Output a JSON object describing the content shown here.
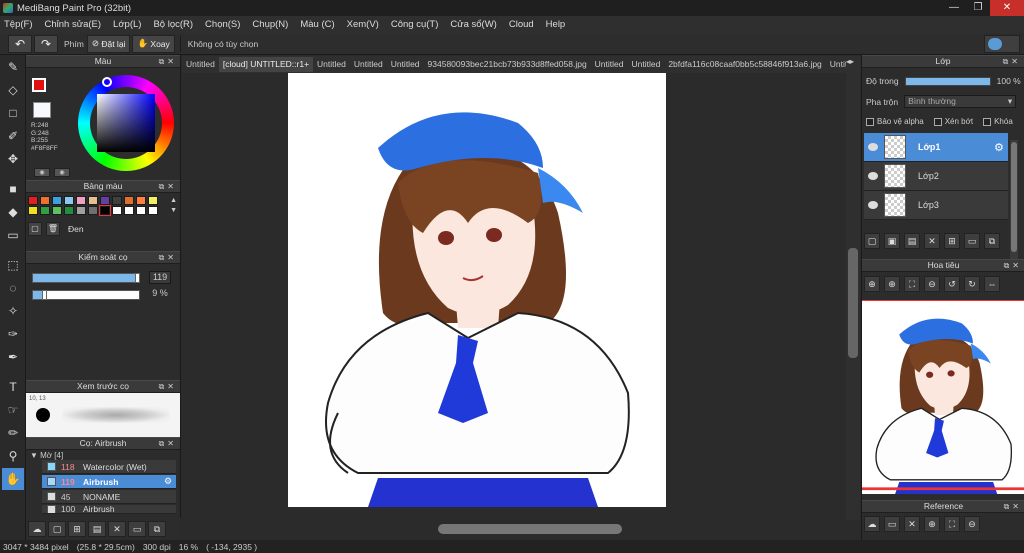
{
  "window": {
    "title": "MediBang Paint Pro (32bit)",
    "min": "—",
    "restore": "❐",
    "close": "✕"
  },
  "menu": [
    {
      "label": "Tệp(F)"
    },
    {
      "label": "Chỉnh sửa(E)"
    },
    {
      "label": "Lớp(L)"
    },
    {
      "label": "Bộ lọc(R)"
    },
    {
      "label": "Chọn(S)"
    },
    {
      "label": "Chụp(N)"
    },
    {
      "label": "Màu (C)"
    },
    {
      "label": "Xem(V)"
    },
    {
      "label": "Công cụ(T)"
    },
    {
      "label": "Cửa sổ(W)"
    },
    {
      "label": "Cloud"
    },
    {
      "label": "Help"
    }
  ],
  "toolbar": {
    "undo": "↶",
    "redo": "↷",
    "key_label": "Phím",
    "reset_label": "Đặt lại",
    "rotate_label": "Xoay",
    "no_options": "Không có tùy chọn"
  },
  "panels": {
    "color": "Màu",
    "palette": "Bảng màu",
    "brush_control": "Kiểm soát cọ",
    "brush_preview": "Xem trước cọ",
    "brush": "Cọ: Airbrush",
    "layer": "Lớp",
    "navigator": "Hoa tiêu",
    "reference": "Reference"
  },
  "color": {
    "r": "R:248",
    "g": "G:248",
    "b": "B:255",
    "hex": "#F8F8FF",
    "fg": "#e01010",
    "bg": "#f8f8ff"
  },
  "palette": {
    "colors": [
      "#e02020",
      "#f07030",
      "#3aa0e0",
      "#8ac8f0",
      "#f0a0c0",
      "#e8c090",
      "#6040a0",
      "#404040",
      "#e07030",
      "#ff8040",
      "#f0f060",
      "#f0e020",
      "#30a040",
      "#60c060",
      "#209040",
      "#a0a0a0",
      "#707070",
      "#000000",
      "#ffffff",
      "#ffffff",
      "#ffffff",
      "#ffffff"
    ],
    "selected_name": "Đen"
  },
  "brush_control": {
    "size_value": "119",
    "size_fraction": 0.98,
    "opacity_value": "9 %",
    "opacity_fraction": 0.09
  },
  "brush_preview": {
    "label": "10, 13"
  },
  "brush_list": {
    "group": "Mờ [4]",
    "items": [
      {
        "num": "118",
        "name": "Watercolor (Wet)",
        "color": "#8ad8f8",
        "active": false
      },
      {
        "num": "119",
        "name": "Airbrush",
        "color": "#a8d8f8",
        "active": true
      },
      {
        "num": "45",
        "name": "NONAME",
        "color": "#dddddd",
        "active": false
      },
      {
        "num": "100",
        "name": "Airbrush",
        "color": "#dddddd",
        "active": false
      }
    ]
  },
  "tabs": [
    {
      "label": "Untitled",
      "active": false
    },
    {
      "label": "[cloud] UNTITLED::r1+",
      "active": true
    },
    {
      "label": "Untitled",
      "active": false
    },
    {
      "label": "Untitled",
      "active": false
    },
    {
      "label": "Untitled",
      "active": false
    },
    {
      "label": "934580093bec21bcb73b933d8ffed058.jpg",
      "active": false
    },
    {
      "label": "Untitled",
      "active": false
    },
    {
      "label": "Untitled",
      "active": false
    },
    {
      "label": "2bfdfa116c08caaf0bb5c58846f913a6.jpg",
      "active": false
    },
    {
      "label": "Untitled",
      "active": false
    }
  ],
  "layer": {
    "opacity_label": "Độ trong",
    "opacity_value": "100 %",
    "opacity_fraction": 1.0,
    "blend_label": "Pha trộn",
    "blend_value": "Bình thường",
    "protect_alpha": "Bảo vệ alpha",
    "clipping": "Xén bớt",
    "lock": "Khóa",
    "layers": [
      {
        "name": "Lớp1",
        "active": true
      },
      {
        "name": "Lớp2",
        "active": false
      },
      {
        "name": "Lớp3",
        "active": false
      }
    ]
  },
  "status": {
    "size": "3047 * 3484 pixel",
    "size_cm": "(25.8 * 29.5cm)",
    "dpi": "300 dpi",
    "zoom": "16 %",
    "coords": "( -134, 2935 )"
  }
}
